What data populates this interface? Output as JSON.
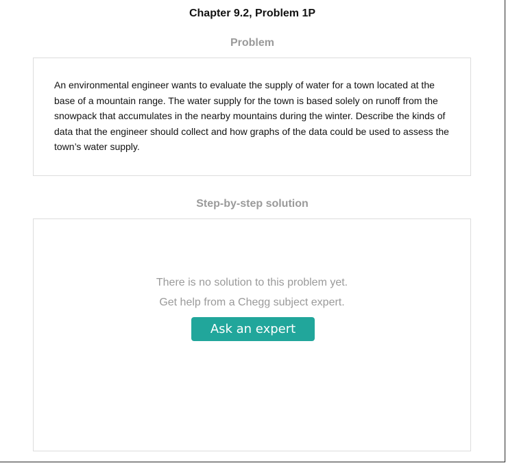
{
  "header": {
    "chapter_title": "Chapter 9.2, Problem 1P"
  },
  "problem": {
    "heading": "Problem",
    "text": "An environmental engineer wants to evaluate the supply of water for a town located at the base of a mountain range. The water supply for the town is based solely on runoff from the snowpack that accumulates in the nearby mountains during the winter. Describe the kinds of data that the engineer should collect and how graphs of the data could be used to assess the town’s water supply."
  },
  "solution": {
    "heading": "Step-by-step solution",
    "message_line1": "There is no solution to this problem yet.",
    "message_line2": "Get help from a Chegg subject expert.",
    "ask_button_label": "Ask an expert"
  },
  "colors": {
    "accent": "#21a69b",
    "heading_gray": "#9a9a9a",
    "card_border": "#dcdcdc"
  }
}
